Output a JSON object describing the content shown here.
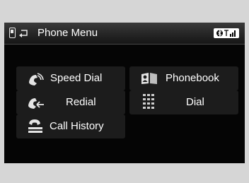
{
  "header": {
    "title": "Phone Menu",
    "icons": [
      "phone-icon",
      "back-icon",
      "bluetooth-icon",
      "signal-icon"
    ]
  },
  "menu": {
    "items": [
      {
        "label": "Speed Dial",
        "icon": "speed-dial-icon"
      },
      {
        "label": "Phonebook",
        "icon": "phonebook-icon"
      },
      {
        "label": "Redial",
        "icon": "redial-icon"
      },
      {
        "label": "Dial",
        "icon": "keypad-icon"
      },
      {
        "label": "Call History",
        "icon": "call-history-icon"
      }
    ]
  },
  "colors": {
    "screen_bg": "#050505",
    "button_bg": "#1c1c1c",
    "text": "#ffffff",
    "frame": "#d6d6d6"
  }
}
